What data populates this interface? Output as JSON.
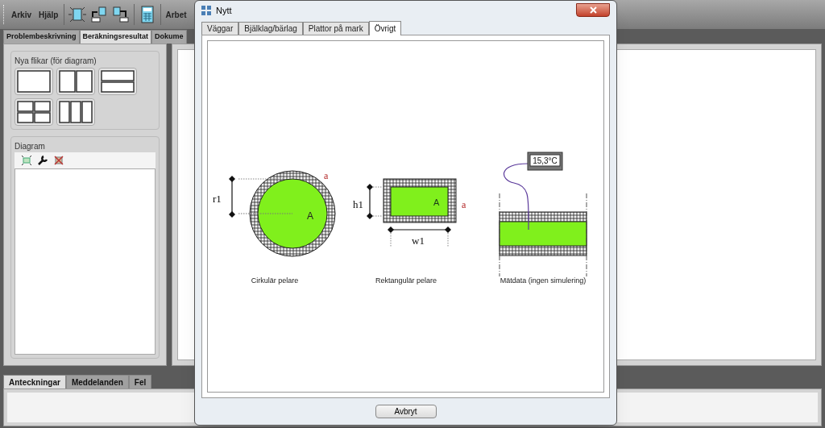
{
  "app": {
    "menu": [
      "Arkiv",
      "Hjälp"
    ],
    "toolbar_text": "Arbet",
    "tabs": [
      {
        "label": "Problembeskrivning",
        "selected": false
      },
      {
        "label": "Beräkningsresultat",
        "selected": true
      },
      {
        "label": "Dokume",
        "selected": false
      }
    ],
    "tiles_group": "Nya flikar (för diagram)",
    "tiles": [
      {
        "kind": "single"
      },
      {
        "kind": "two-columns"
      },
      {
        "kind": "two-rows"
      },
      {
        "kind": "grid"
      },
      {
        "kind": "three-columns"
      }
    ],
    "diagram_group": "Diagram",
    "bottom_tabs": [
      {
        "label": "Anteckningar",
        "selected": true
      },
      {
        "label": "Meddelanden",
        "selected": false
      },
      {
        "label": "Fel",
        "selected": false
      }
    ]
  },
  "dialog": {
    "title": "Nytt",
    "tabs": [
      {
        "label": "Väggar",
        "selected": false
      },
      {
        "label": "Bjälklag/bärlag",
        "selected": false
      },
      {
        "label": "Plattor på mark",
        "selected": false
      },
      {
        "label": "Övrigt",
        "selected": true
      }
    ],
    "figures": [
      {
        "kind": "circular",
        "caption": "Cirkulär pelare",
        "dimension": "r1",
        "area": "A",
        "surface": "a"
      },
      {
        "kind": "rectangular",
        "caption": "Rektangulär pelare",
        "height": "h1",
        "width": "w1",
        "area": "A",
        "surface": "a"
      },
      {
        "kind": "measured",
        "caption": "Mätdata (ingen simulering)",
        "reading": "15,3°C"
      }
    ],
    "cancel_button": "Avbryt"
  }
}
